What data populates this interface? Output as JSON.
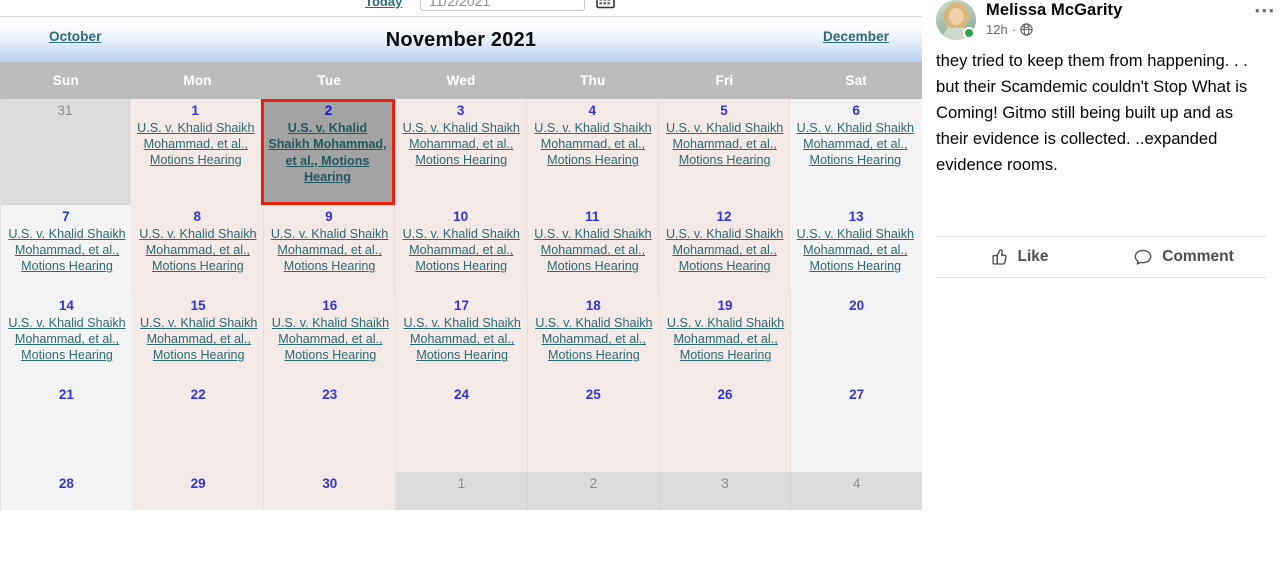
{
  "picker": {
    "today_label": "Today",
    "date_value": "11/2/2021",
    "calendar_icon": "calendar-picker-icon"
  },
  "calendar": {
    "prev_month": "October",
    "title": "November 2021",
    "next_month": "December",
    "weekday_headers": [
      "Sun",
      "Mon",
      "Tue",
      "Wed",
      "Thu",
      "Fri",
      "Sat"
    ],
    "event_title": "U.S. v. Khalid Shaikh Mohammad, et al., Motions Hearing",
    "colors": {
      "weekday_cell": "#f3e9e7",
      "weekend_cell": "#f4f3f3",
      "other_month_cell": "#dcdcdc",
      "header_row": "#bcbcbc",
      "selected_cell": "#a3a3a3",
      "selection_border": "#f01e0c",
      "day_number": "#3333dd",
      "event_link": "#2e6b72"
    },
    "weeks": [
      [
        {
          "day": "31",
          "other": true,
          "event": ""
        },
        {
          "day": "1",
          "other": false,
          "event": "U.S. v. Khalid Shaikh Mohammad, et al., Motions Hearing"
        },
        {
          "day": "2",
          "other": false,
          "event": "U.S. v. Khalid Shaikh Mohammad, et al., Motions Hearing",
          "selected": true
        },
        {
          "day": "3",
          "other": false,
          "event": "U.S. v. Khalid Shaikh Mohammad, et al., Motions Hearing"
        },
        {
          "day": "4",
          "other": false,
          "event": "U.S. v. Khalid Shaikh Mohammad, et al., Motions Hearing"
        },
        {
          "day": "5",
          "other": false,
          "event": "U.S. v. Khalid Shaikh Mohammad, et al., Motions Hearing"
        },
        {
          "day": "6",
          "other": false,
          "event": "U.S. v. Khalid Shaikh Mohammad, et al., Motions Hearing"
        }
      ],
      [
        {
          "day": "7",
          "other": false,
          "event": "U.S. v. Khalid Shaikh Mohammad, et al., Motions Hearing"
        },
        {
          "day": "8",
          "other": false,
          "event": "U.S. v. Khalid Shaikh Mohammad, et al., Motions Hearing"
        },
        {
          "day": "9",
          "other": false,
          "event": "U.S. v. Khalid Shaikh Mohammad, et al., Motions Hearing"
        },
        {
          "day": "10",
          "other": false,
          "event": "U.S. v. Khalid Shaikh Mohammad, et al., Motions Hearing"
        },
        {
          "day": "11",
          "other": false,
          "event": "U.S. v. Khalid Shaikh Mohammad, et al., Motions Hearing"
        },
        {
          "day": "12",
          "other": false,
          "event": "U.S. v. Khalid Shaikh Mohammad, et al., Motions Hearing"
        },
        {
          "day": "13",
          "other": false,
          "event": "U.S. v. Khalid Shaikh Mohammad, et al., Motions Hearing"
        }
      ],
      [
        {
          "day": "14",
          "other": false,
          "event": "U.S. v. Khalid Shaikh Mohammad, et al., Motions Hearing"
        },
        {
          "day": "15",
          "other": false,
          "event": "U.S. v. Khalid Shaikh Mohammad, et al., Motions Hearing"
        },
        {
          "day": "16",
          "other": false,
          "event": "U.S. v. Khalid Shaikh Mohammad, et al., Motions Hearing"
        },
        {
          "day": "17",
          "other": false,
          "event": "U.S. v. Khalid Shaikh Mohammad, et al., Motions Hearing"
        },
        {
          "day": "18",
          "other": false,
          "event": "U.S. v. Khalid Shaikh Mohammad, et al., Motions Hearing"
        },
        {
          "day": "19",
          "other": false,
          "event": "U.S. v. Khalid Shaikh Mohammad, et al., Motions Hearing"
        },
        {
          "day": "20",
          "other": false,
          "event": ""
        }
      ],
      [
        {
          "day": "21",
          "other": false,
          "event": ""
        },
        {
          "day": "22",
          "other": false,
          "event": ""
        },
        {
          "day": "23",
          "other": false,
          "event": ""
        },
        {
          "day": "24",
          "other": false,
          "event": ""
        },
        {
          "day": "25",
          "other": false,
          "event": ""
        },
        {
          "day": "26",
          "other": false,
          "event": ""
        },
        {
          "day": "27",
          "other": false,
          "event": ""
        }
      ],
      [
        {
          "day": "28",
          "other": false,
          "event": ""
        },
        {
          "day": "29",
          "other": false,
          "event": ""
        },
        {
          "day": "30",
          "other": false,
          "event": ""
        },
        {
          "day": "1",
          "other": true,
          "event": ""
        },
        {
          "day": "2",
          "other": true,
          "event": ""
        },
        {
          "day": "3",
          "other": true,
          "event": ""
        },
        {
          "day": "4",
          "other": true,
          "event": ""
        }
      ]
    ]
  },
  "post": {
    "author": "Melissa McGarity",
    "time": "12h",
    "separator": "·",
    "audience_icon": "globe-icon",
    "menu_icon": "more-options-icon",
    "body": "they tried to keep them from happening. . . but their Scamdemic couldn't Stop What is Coming! Gitmo still being built up and as their evidence is collected. ..expanded evidence rooms.",
    "actions": [
      {
        "label": "Like",
        "icon": "thumbs-up-icon"
      },
      {
        "label": "Comment",
        "icon": "comment-bubble-icon"
      }
    ],
    "online_status": "online-indicator"
  }
}
